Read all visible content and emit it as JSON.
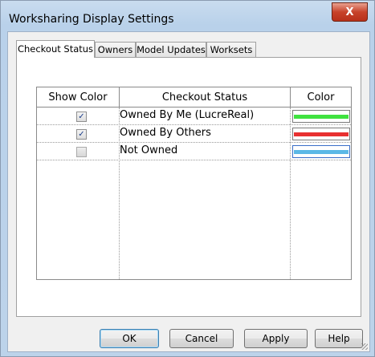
{
  "window": {
    "title": "Worksharing Display Settings",
    "close_glyph": "X"
  },
  "tabs": [
    {
      "label": "Checkout Status",
      "active": true
    },
    {
      "label": "Owners",
      "active": false
    },
    {
      "label": "Model Updates",
      "active": false
    },
    {
      "label": "Worksets",
      "active": false
    }
  ],
  "table": {
    "headers": [
      "Show Color",
      "Checkout Status",
      "Color"
    ],
    "rows": [
      {
        "checked": true,
        "check_glyph": "✓",
        "status": "Owned By Me (LucreReal)",
        "color": "#3fe23f"
      },
      {
        "checked": true,
        "check_glyph": "✓",
        "status": "Owned By Others",
        "color": "#e83030"
      },
      {
        "checked": false,
        "check_glyph": "",
        "status": "Not Owned",
        "color": "#5bb8e6"
      }
    ]
  },
  "buttons": {
    "ok": "OK",
    "cancel": "Cancel",
    "apply": "Apply",
    "help": "Help"
  },
  "colors": {
    "accent": "#3c7fb1",
    "titlebar": "#bcd3ea",
    "close": "#c7432a"
  }
}
